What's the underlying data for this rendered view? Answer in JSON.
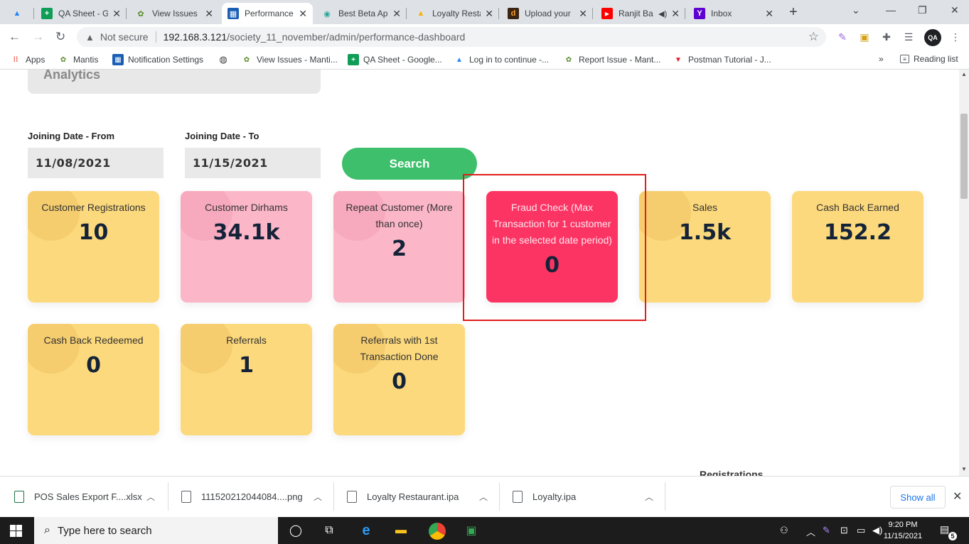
{
  "tabs": [
    {
      "title": "",
      "icon": "atlassian-icon",
      "close": ""
    },
    {
      "title": "QA Sheet - G",
      "icon": "google-sheets-icon",
      "close": "✕"
    },
    {
      "title": "View Issues",
      "icon": "mantis-icon",
      "close": "✕"
    },
    {
      "title": "Performance",
      "icon": "dashboard-icon",
      "close": "✕"
    },
    {
      "title": "Best Beta Ap",
      "icon": "beta-app-icon",
      "close": "✕"
    },
    {
      "title": "Loyalty Resta",
      "icon": "google-drive-icon",
      "close": "✕"
    },
    {
      "title": "Upload your",
      "icon": "upload-d-icon",
      "close": "✕"
    },
    {
      "title": "Ranjit Ba",
      "icon": "youtube-icon",
      "close": "✕"
    },
    {
      "title": "Inbox",
      "icon": "yahoo-mail-icon",
      "close": "✕"
    }
  ],
  "address_bar": {
    "security": "Not secure",
    "host": "192.168.3.121",
    "path": "/society_11_november/admin/performance-dashboard"
  },
  "bookmarks": [
    {
      "label": "Apps",
      "icon": "apps-grid-icon"
    },
    {
      "label": "Mantis",
      "icon": "mantis-icon"
    },
    {
      "label": "Notification Settings",
      "icon": "dashboard-icon"
    },
    {
      "label": "",
      "icon": "globe-icon"
    },
    {
      "label": "View Issues - Manti...",
      "icon": "mantis-icon"
    },
    {
      "label": "QA Sheet - Google...",
      "icon": "google-sheets-icon"
    },
    {
      "label": "Log in to continue -...",
      "icon": "atlassian-icon"
    },
    {
      "label": "Report Issue - Mant...",
      "icon": "mantis-icon"
    },
    {
      "label": "Postman Tutorial - J...",
      "icon": "postman-icon"
    }
  ],
  "bookmarks_overflow": "»",
  "reading_list": "Reading list",
  "dashboard": {
    "section_title": "Analytics",
    "from_label": "Joining Date - From",
    "from_value": "11/08/2021",
    "to_label": "Joining Date - To",
    "to_value": "11/15/2021",
    "search_label": "Search",
    "cards": [
      {
        "title": "Customer Registrations",
        "value": "10",
        "color": "yellow"
      },
      {
        "title": "Customer Dirhams",
        "value": "34.1k",
        "color": "pink"
      },
      {
        "title": "Repeat Customer (More than once)",
        "value": "2",
        "color": "pink"
      },
      {
        "title": "Fraud Check (Max Transaction for 1 customer in the selected date period)",
        "value": "0",
        "color": "red"
      },
      {
        "title": "Sales",
        "value": "1.5k",
        "color": "yellow"
      },
      {
        "title": "Cash Back Earned",
        "value": "152.2",
        "color": "yellow"
      },
      {
        "title": "Cash Back Redeemed",
        "value": "0",
        "color": "yellow"
      },
      {
        "title": "Referrals",
        "value": "1",
        "color": "yellow"
      },
      {
        "title": "Referrals with 1st Transaction Done",
        "value": "0",
        "color": "yellow"
      }
    ],
    "next_section_heading": "Registrations"
  },
  "downloads": [
    {
      "name": "POS Sales Export F....xlsx"
    },
    {
      "name": "111520212044084....png"
    },
    {
      "name": "Loyalty Restaurant.ipa"
    },
    {
      "name": "Loyalty.ipa"
    }
  ],
  "downloads_show_all": "Show all",
  "taskbar": {
    "search_placeholder": "Type here to search",
    "time": "9:20 PM",
    "date": "11/15/2021",
    "notification_count": "5"
  },
  "colors": {
    "accent_green": "#3dbf6b",
    "card_yellow": "#fcd97c",
    "card_pink": "#fbb6c8",
    "card_red": "#fc3464",
    "highlight_red": "#e21d1d"
  }
}
